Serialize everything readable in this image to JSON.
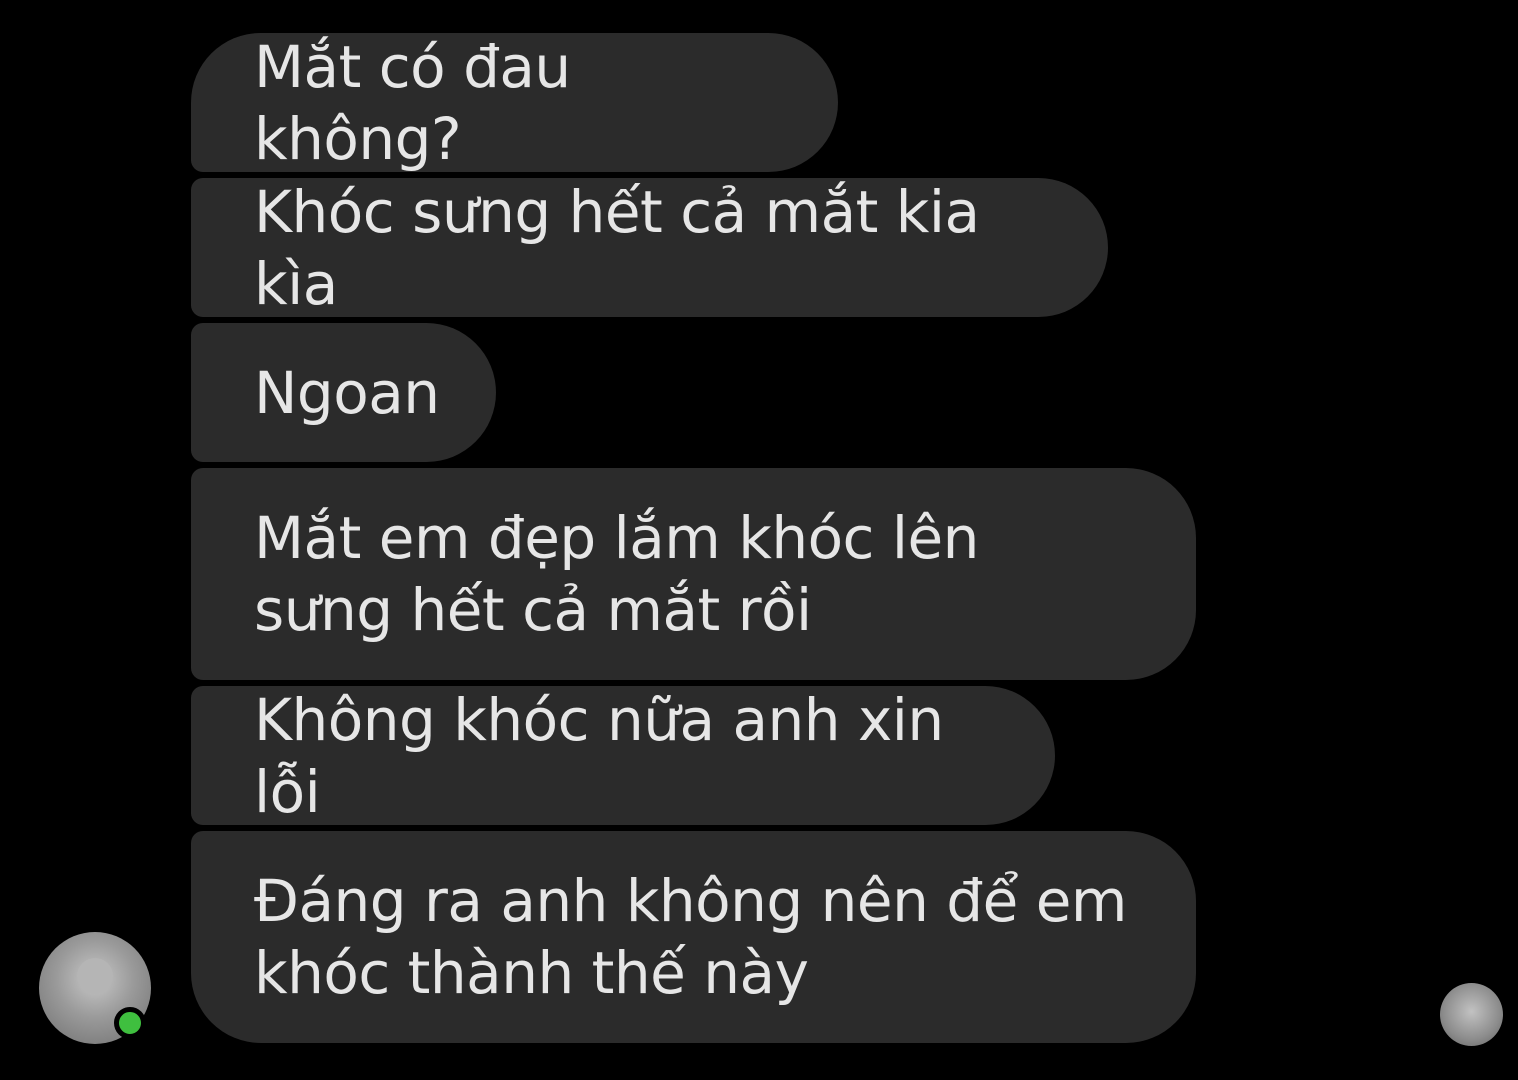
{
  "conversation": {
    "messages": [
      {
        "text": "Mắt có đau không?"
      },
      {
        "text": "Khóc sưng hết cả mắt kia kìa"
      },
      {
        "text": "Ngoan"
      },
      {
        "text": "Mắt em đẹp lắm khóc lên sưng hết cả mắt rồi"
      },
      {
        "text": "Không khóc nữa anh xin lỗi"
      },
      {
        "text": "Đáng ra anh không nên để em khóc thành thế này"
      }
    ],
    "sender": {
      "avatar_icon": "user-avatar-icon",
      "online_status_color": "#3fbf3f"
    },
    "seen_indicator": {
      "icon": "seen-avatar-icon"
    },
    "colors": {
      "background": "#000000",
      "bubble": "#2b2b2b",
      "text": "#e6e6e6"
    }
  }
}
